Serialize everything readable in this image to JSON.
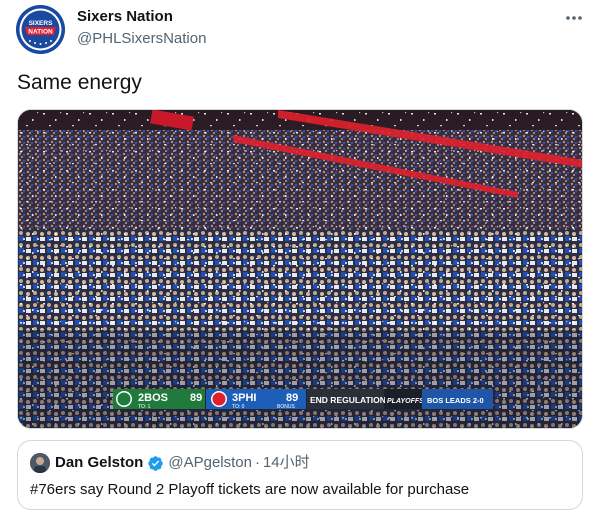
{
  "author": {
    "display_name": "Sixers Nation",
    "handle": "@PHLSixersNation",
    "avatar_text_top": "SIXERS",
    "avatar_text_bottom": "NATION"
  },
  "tweet": {
    "text": "Same energy"
  },
  "media": {
    "description_icon": "arena-crowd-video",
    "scoreboard": {
      "away_seed": "2",
      "away_team": "BOS",
      "away_score": "89",
      "away_timeouts": "TO: 1",
      "home_seed": "3",
      "home_team": "PHI",
      "home_score": "89",
      "home_timeouts": "TO: 0",
      "home_bonus": "BONUS",
      "status": "END REGULATION",
      "playoffs_label": "PLAYOFFS",
      "series_status": "BOS LEADS 2-0"
    },
    "colors": {
      "celtics_green": "#1f7a3c",
      "sixers_blue": "#1d5fb8",
      "dark_panel": "#1b1f2a",
      "ribbon_red": "#e0202c"
    }
  },
  "quoted_tweet": {
    "display_name": "Dan Gelston",
    "verified": true,
    "handle": "@APgelston",
    "separator": "·",
    "time": "14小时",
    "text": "#76ers say Round 2 Playoff tickets are now available for purchase"
  },
  "icons": {
    "more": "more-horizontal-icon",
    "verified": "verified-badge-icon"
  }
}
